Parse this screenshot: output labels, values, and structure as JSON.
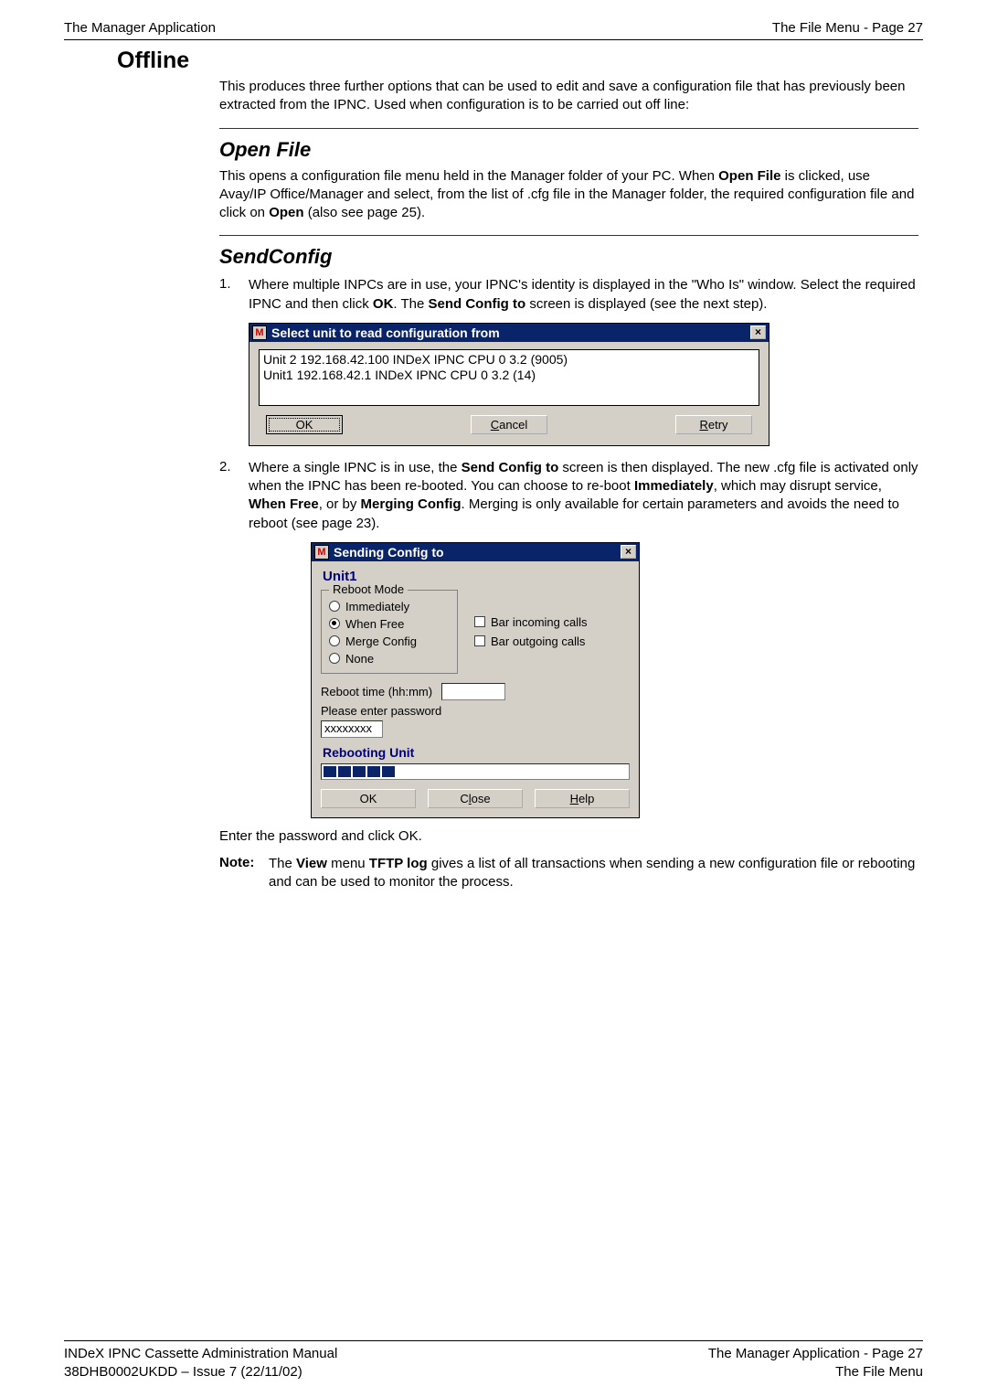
{
  "header": {
    "left": "The Manager Application",
    "right": "The File Menu - Page 27"
  },
  "section_title": "Offline",
  "intro_para": "This produces three further options that can be used to edit and save a configuration file that has previously been extracted from the IPNC. Used when configuration is to be carried out off line:",
  "open_file": {
    "title": "Open File",
    "para_parts": {
      "a": "This opens a configuration file menu held in the Manager folder of your PC. When ",
      "b": "Open File",
      "c": " is clicked, use Avay/IP Office/Manager and select, from the list of .cfg file in the Manager folder, the required configuration file and click on ",
      "d": "Open",
      "e": " (also see page 25)."
    }
  },
  "send_config": {
    "title": "SendConfig",
    "step1": {
      "num": "1.",
      "parts": {
        "a": "Where multiple INPCs are in use, your IPNC's identity is displayed in the \"Who Is\" window. Select the required IPNC and then click ",
        "b": "OK",
        "c": ". The ",
        "d": "Send Config to",
        "e": " screen is displayed (see the next step)."
      }
    },
    "dlg1": {
      "title": "Select unit to read configuration from",
      "list_line1": "Unit 2  192.168.42.100  INDeX IPNC  CPU  0  3.2 (9005)",
      "list_line2": "Unit1  192.168.42.1  INDeX IPNC  CPU  0  3.2 (14)",
      "ok": "OK",
      "cancel_u": "C",
      "cancel_rest": "ancel",
      "retry_u": "R",
      "retry_rest": "etry",
      "close_x": "×"
    },
    "step2": {
      "num": "2.",
      "parts": {
        "a": "Where a single IPNC is in use, the ",
        "b": "Send Config to",
        "c": " screen is then displayed. The new .cfg file is activated only when the IPNC has been re-booted. You can choose to re-boot ",
        "d": "Immediately",
        "e": ", which may disrupt service, ",
        "f": "When Free",
        "g": ", or by ",
        "h": "Merging Config",
        "i": ". Merging is only available for certain parameters and avoids the need to reboot (see page 23)."
      }
    },
    "dlg2": {
      "title": "Sending Config to",
      "unit_label": "Unit1",
      "group_legend": "Reboot Mode",
      "radios": {
        "immediately": "Immediately",
        "when_free": "When Free",
        "merge_config": "Merge Config",
        "none": "None"
      },
      "checks": {
        "bar_in": "Bar incoming calls",
        "bar_out": "Bar outgoing calls"
      },
      "reboot_time_label": "Reboot time (hh:mm)",
      "pwd_label": "Please enter password",
      "pwd_value": "xxxxxxxx",
      "rebooting_label": "Rebooting Unit",
      "ok": "OK",
      "close_u": "l",
      "close_pre": "C",
      "close_post": "ose",
      "help_u": "H",
      "help_rest": "elp",
      "close_x": "×"
    },
    "enter_pwd": "Enter the password and click OK.",
    "note": {
      "label": "Note:",
      "parts": {
        "a": "The ",
        "b": "View",
        "c": " menu ",
        "d": "TFTP log",
        "e": " gives a list of all transactions when sending a new configuration file or rebooting and can be used to monitor the process."
      }
    }
  },
  "footer": {
    "left_line1": "INDeX IPNC Cassette Administration Manual",
    "left_line2": "38DHB0002UKDD – Issue 7 (22/11/02)",
    "right_line1": "The Manager Application - Page 27",
    "right_line2": "The File Menu"
  }
}
